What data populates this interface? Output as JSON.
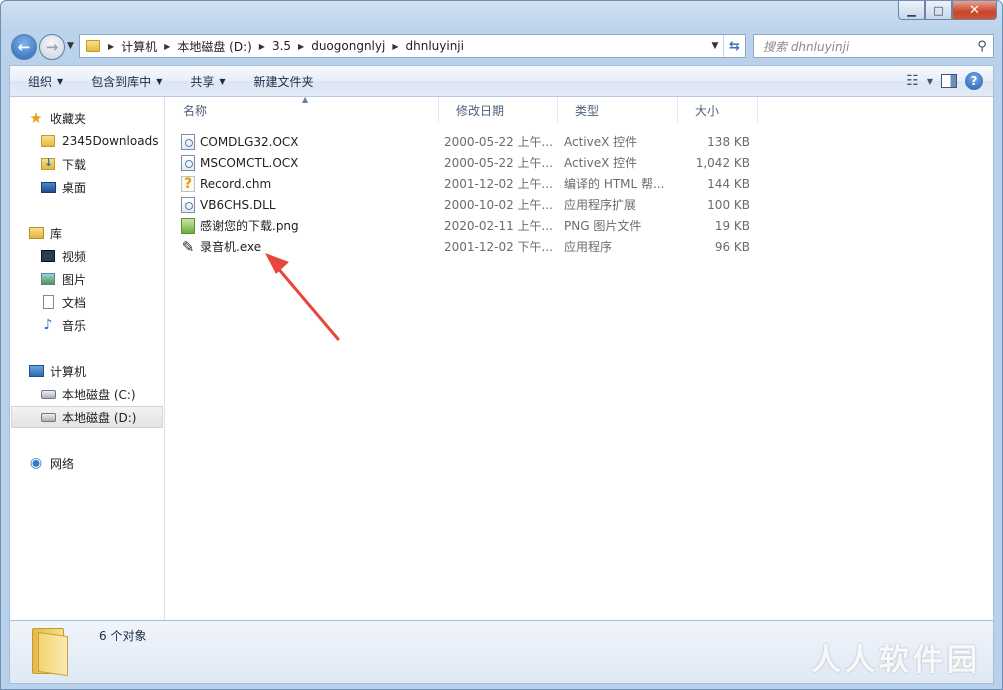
{
  "address": {
    "crumbs": [
      "计算机",
      "本地磁盘 (D:)",
      "3.5",
      "duogongnlyj",
      "dhnluyinji"
    ]
  },
  "search": {
    "placeholder": "搜索 dhnluyinji"
  },
  "toolbar": {
    "organize": "组织",
    "include_library": "包含到库中",
    "share": "共享",
    "new_folder": "新建文件夹"
  },
  "sidebar": {
    "favorites": "收藏夹",
    "fav_items": [
      "2345Downloads",
      "下载",
      "桌面"
    ],
    "libraries": "库",
    "lib_items": [
      "视频",
      "图片",
      "文档",
      "音乐"
    ],
    "computer": "计算机",
    "drives": [
      "本地磁盘 (C:)",
      "本地磁盘 (D:)"
    ],
    "network": "网络"
  },
  "columns": {
    "name": "名称",
    "date": "修改日期",
    "type": "类型",
    "size": "大小"
  },
  "files": [
    {
      "name": "COMDLG32.OCX",
      "date": "2000-05-22 上午...",
      "type": "ActiveX 控件",
      "size": "138 KB",
      "icon": "ocx-icon"
    },
    {
      "name": "MSCOMCTL.OCX",
      "date": "2000-05-22 上午...",
      "type": "ActiveX 控件",
      "size": "1,042 KB",
      "icon": "ocx-icon"
    },
    {
      "name": "Record.chm",
      "date": "2001-12-02 上午...",
      "type": "编译的 HTML 帮...",
      "size": "144 KB",
      "icon": "help-file-icon"
    },
    {
      "name": "VB6CHS.DLL",
      "date": "2000-10-02 上午...",
      "type": "应用程序扩展",
      "size": "100 KB",
      "icon": "dll-icon"
    },
    {
      "name": "感谢您的下载.png",
      "date": "2020-02-11 上午...",
      "type": "PNG 图片文件",
      "size": "19 KB",
      "icon": "png-icon"
    },
    {
      "name": "录音机.exe",
      "date": "2001-12-02 下午...",
      "type": "应用程序",
      "size": "96 KB",
      "icon": "exe-icon"
    }
  ],
  "status": {
    "count": "6 个对象"
  },
  "watermark": "人人软件园",
  "colors": {
    "arrow": "#e8453c",
    "accent": "#2f6bc2"
  }
}
